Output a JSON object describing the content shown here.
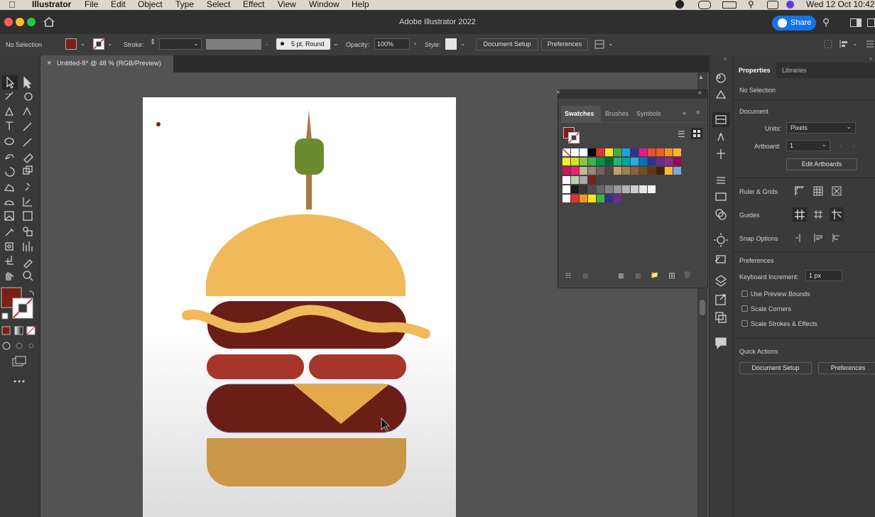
{
  "menubar": {
    "apple": "",
    "app": "Illustrator",
    "items": [
      "File",
      "Edit",
      "Object",
      "Type",
      "Select",
      "Effect",
      "View",
      "Window",
      "Help"
    ],
    "datetime": "Wed 12 Oct 10:42"
  },
  "titlebar": {
    "title": "Adobe Illustrator 2022",
    "share": "Share"
  },
  "controlbar": {
    "selection": "No Selection",
    "stroke_label": "Stroke:",
    "brush": "5 pt. Round",
    "opacity_label": "Opacity:",
    "opacity": "100%",
    "style_label": "Style:",
    "doc_setup": "Document Setup",
    "preferences": "Preferences"
  },
  "tab": {
    "label": "Untitled-8* @ 48 % (RGB/Preview)"
  },
  "swatches": {
    "tabs": [
      "Swatches",
      "Brushes",
      "Symbols"
    ]
  },
  "properties": {
    "tabs": [
      "Properties",
      "Libraries"
    ],
    "no_selection": "No Selection",
    "document": "Document",
    "units_label": "Units:",
    "units": "Pixels",
    "artboard_label": "Artboard:",
    "artboard": "1",
    "edit_artboards": "Edit Artboards",
    "ruler_grids": "Ruler & Grids",
    "guides": "Guides",
    "snap": "Snap Options",
    "preferences": "Preferences",
    "kbd_label": "Keyboard Increment:",
    "kbd": "1 px",
    "checks": [
      "Use Preview Bounds",
      "Scale Corners",
      "Scale Strokes & Effects"
    ],
    "quick_actions": "Quick Actions",
    "doc_setup": "Document Setup",
    "prefs_btn": "Preferences"
  },
  "colors": {
    "fill": "#7b1f17",
    "bun": "#f0b95a",
    "patty": "#6b1e16",
    "tomato": "#a8352c",
    "olive": "#6a8c2e",
    "accent": "#1473e6"
  }
}
